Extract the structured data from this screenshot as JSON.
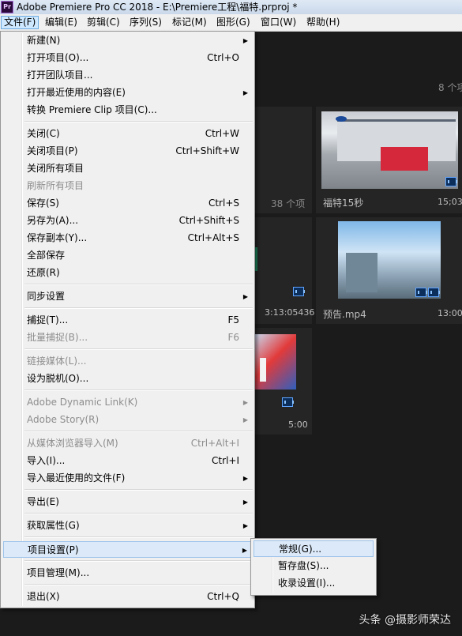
{
  "window": {
    "app_icon": "Pr",
    "title": "Adobe Premiere Pro CC 2018 - E:\\Premiere工程\\福特.prproj *"
  },
  "menubar": [
    {
      "label": "文件(F)",
      "active": true
    },
    {
      "label": "编辑(E)"
    },
    {
      "label": "剪辑(C)"
    },
    {
      "label": "序列(S)"
    },
    {
      "label": "标记(M)"
    },
    {
      "label": "图形(G)"
    },
    {
      "label": "窗口(W)"
    },
    {
      "label": "帮助(H)"
    }
  ],
  "project_panel": {
    "item_count_right": "8 个项",
    "item_count_left": "38 个项",
    "partial_duration_left": "3:13:05436",
    "partial_duration_bottom": "5:00",
    "tiles": [
      {
        "name": "福特15秒",
        "duration": "15;03"
      },
      {
        "name": "预告.mp4",
        "duration": "13:00"
      }
    ]
  },
  "file_menu": {
    "items": [
      {
        "label": "新建(N)",
        "shortcut": "",
        "submenu": true
      },
      {
        "label": "打开项目(O)...",
        "shortcut": "Ctrl+O"
      },
      {
        "label": "打开团队项目...",
        "shortcut": ""
      },
      {
        "label": "打开最近使用的内容(E)",
        "shortcut": "",
        "submenu": true
      },
      {
        "label": "转换 Premiere Clip 项目(C)...",
        "shortcut": ""
      },
      {
        "label": "关闭(C)",
        "shortcut": "Ctrl+W"
      },
      {
        "label": "关闭项目(P)",
        "shortcut": "Ctrl+Shift+W"
      },
      {
        "label": "关闭所有项目",
        "shortcut": ""
      },
      {
        "label": "刷新所有项目",
        "shortcut": "",
        "disabled": true
      },
      {
        "label": "保存(S)",
        "shortcut": "Ctrl+S"
      },
      {
        "label": "另存为(A)...",
        "shortcut": "Ctrl+Shift+S"
      },
      {
        "label": "保存副本(Y)...",
        "shortcut": "Ctrl+Alt+S"
      },
      {
        "label": "全部保存",
        "shortcut": ""
      },
      {
        "label": "还原(R)",
        "shortcut": ""
      },
      {
        "label": "同步设置",
        "shortcut": "",
        "submenu": true
      },
      {
        "label": "捕捉(T)...",
        "shortcut": "F5"
      },
      {
        "label": "批量捕捉(B)...",
        "shortcut": "F6",
        "disabled": true
      },
      {
        "label": "链接媒体(L)...",
        "shortcut": "",
        "disabled": true
      },
      {
        "label": "设为脱机(O)...",
        "shortcut": ""
      },
      {
        "label": "Adobe Dynamic Link(K)",
        "shortcut": "",
        "submenu": true,
        "disabled": true
      },
      {
        "label": "Adobe Story(R)",
        "shortcut": "",
        "submenu": true,
        "disabled": true
      },
      {
        "label": "从媒体浏览器导入(M)",
        "shortcut": "Ctrl+Alt+I",
        "disabled": true
      },
      {
        "label": "导入(I)...",
        "shortcut": "Ctrl+I"
      },
      {
        "label": "导入最近使用的文件(F)",
        "shortcut": "",
        "submenu": true
      },
      {
        "label": "导出(E)",
        "shortcut": "",
        "submenu": true
      },
      {
        "label": "获取属性(G)",
        "shortcut": "",
        "submenu": true
      },
      {
        "label": "项目设置(P)",
        "shortcut": "",
        "submenu": true,
        "highlighted": true
      },
      {
        "label": "项目管理(M)...",
        "shortcut": ""
      },
      {
        "label": "退出(X)",
        "shortcut": "Ctrl+Q"
      }
    ]
  },
  "project_settings_submenu": {
    "items": [
      {
        "label": "常规(G)...",
        "highlighted": true
      },
      {
        "label": "暂存盘(S)..."
      },
      {
        "label": "收录设置(I)..."
      }
    ]
  },
  "watermark": "头条 @摄影师荣达",
  "colors": {
    "menu_bg": "#f0f0f0",
    "highlight_bg": "#dbe9f8",
    "app_bg": "#1b1b1b",
    "disabled_text": "#8d8d8d"
  }
}
